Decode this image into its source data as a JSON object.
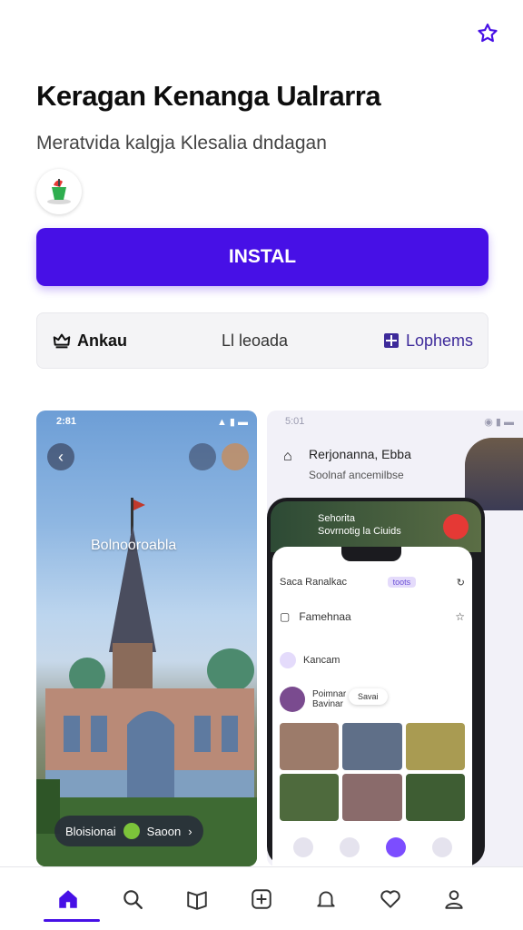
{
  "app": {
    "title": "Keragan Kenanga Ualrarra",
    "subtitle": "Meratvida kalgja Klesalia dndagan",
    "install_label": "INSTAL"
  },
  "info_bar": {
    "rating_label": "Ankau",
    "reviews_label": "Ll leoada",
    "category_label": "Lophems"
  },
  "screenshot1": {
    "status_time": "2:81",
    "overlay_label": "Bolnooroabla",
    "pill_left": "Bloisionai",
    "pill_right": "Saoon"
  },
  "screenshot2": {
    "status_time": "5:01",
    "header_title": "Rerjonanna, Ebba",
    "header_sub": "Soolnaf ancemilbse",
    "phone_top_text": "Sehorita",
    "phone_top_sub": "Sovrnotig la Ciuids",
    "app_header": "Saca Ranalkac",
    "chip_label": "toots",
    "search_text": "Famehnaa",
    "row_label": "Kancam",
    "row2_title": "Poimnar",
    "row2_sub": "Bavinar",
    "toast_label": "Savai"
  },
  "colors": {
    "accent": "#4710e6",
    "accent_dark": "#3d2a9a"
  },
  "tabs": [
    "home-icon",
    "search-icon",
    "library-icon",
    "add-icon",
    "notifications-icon",
    "favorites-icon",
    "profile-icon"
  ]
}
